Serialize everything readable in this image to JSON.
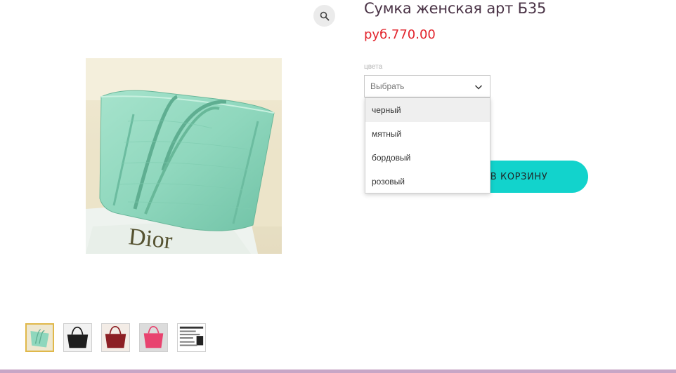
{
  "product": {
    "title": "Сумка женская арт Б35",
    "price": "руб.770.00"
  },
  "options": {
    "color_label": "цвета",
    "select_placeholder": "Выбрать",
    "dropdown_items": [
      "черный",
      "мятный",
      "бордовый",
      "розовый"
    ],
    "highlighted_index": 0
  },
  "cart": {
    "button_label": "В КОРЗИНУ"
  },
  "gallery": {
    "thumbnails": [
      "mint",
      "black",
      "burgundy",
      "pink",
      "size-chart"
    ],
    "active_index": 0,
    "main_image_text": "Dior"
  },
  "icons": {
    "zoom": "magnifier-icon",
    "select": "chevron-down-icon"
  },
  "colors": {
    "price": "#e2242c",
    "title": "#4a3346",
    "cart_button": "#12d3cc",
    "active_thumb_border": "#e0b84a",
    "footer_bar": "#c8a6c6"
  }
}
